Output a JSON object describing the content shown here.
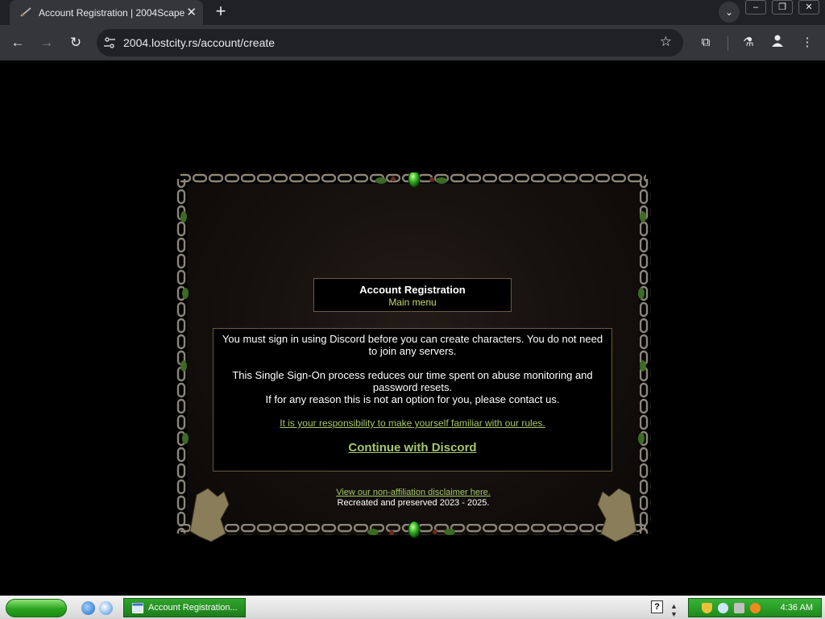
{
  "browser": {
    "tab_title": "Account Registration | 2004Scape",
    "url": "2004.lostcity.rs/account/create",
    "icons": [
      "favicon-icon",
      "tab-close-icon",
      "new-tab-icon",
      "tab-search-icon",
      "back-icon",
      "forward-icon",
      "reload-icon",
      "site-info-icon",
      "bookmark-star-icon",
      "extensions-icon",
      "labs-icon",
      "profile-icon",
      "menu-icon"
    ],
    "window_controls": {
      "minimize": "–",
      "restore": "❐",
      "close": "✕"
    }
  },
  "page": {
    "title": "Account Registration",
    "main_menu_link": "Main menu",
    "paragraph1": "You must sign in using Discord before you can create characters. You do not need to join any servers.",
    "paragraph2": "This Single Sign-On process reduces our time spent on abuse monitoring and password resets.",
    "paragraph3": "If for any reason this is not an option for you, please contact us.",
    "rules_link": "It is your responsibility to make yourself familiar with our rules.",
    "discord_link": "Continue with Discord",
    "disclaimer_link": "View our non-affiliation disclaimer here.",
    "copyright": "Recreated and preserved 2023 - 2025.",
    "colors": {
      "link": "#a6c86c",
      "title_link": "#c6d86f",
      "border": "#6b5a3c",
      "gem": "#3fbf2a"
    }
  },
  "taskbar": {
    "task_label": "Account Registration...",
    "help_label": "?",
    "clock": "4:36 AM"
  }
}
